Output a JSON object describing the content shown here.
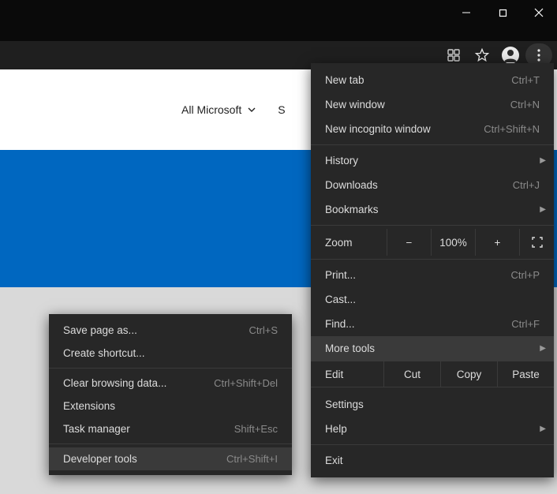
{
  "page": {
    "all_microsoft": "All Microsoft",
    "search_fragment": "S"
  },
  "menu": {
    "new_tab": {
      "label": "New tab",
      "shortcut": "Ctrl+T"
    },
    "new_window": {
      "label": "New window",
      "shortcut": "Ctrl+N"
    },
    "new_incognito": {
      "label": "New incognito window",
      "shortcut": "Ctrl+Shift+N"
    },
    "history": {
      "label": "History"
    },
    "downloads": {
      "label": "Downloads",
      "shortcut": "Ctrl+J"
    },
    "bookmarks": {
      "label": "Bookmarks"
    },
    "zoom": {
      "label": "Zoom",
      "value": "100%",
      "minus": "−",
      "plus": "+"
    },
    "print": {
      "label": "Print...",
      "shortcut": "Ctrl+P"
    },
    "cast": {
      "label": "Cast..."
    },
    "find": {
      "label": "Find...",
      "shortcut": "Ctrl+F"
    },
    "more_tools": {
      "label": "More tools"
    },
    "edit": {
      "label": "Edit",
      "cut": "Cut",
      "copy": "Copy",
      "paste": "Paste"
    },
    "settings": {
      "label": "Settings"
    },
    "help": {
      "label": "Help"
    },
    "exit": {
      "label": "Exit"
    }
  },
  "submenu": {
    "save_page": {
      "label": "Save page as...",
      "shortcut": "Ctrl+S"
    },
    "create_shortcut": {
      "label": "Create shortcut..."
    },
    "clear_browsing": {
      "label": "Clear browsing data...",
      "shortcut": "Ctrl+Shift+Del"
    },
    "extensions": {
      "label": "Extensions"
    },
    "task_manager": {
      "label": "Task manager",
      "shortcut": "Shift+Esc"
    },
    "dev_tools": {
      "label": "Developer tools",
      "shortcut": "Ctrl+Shift+I"
    }
  }
}
